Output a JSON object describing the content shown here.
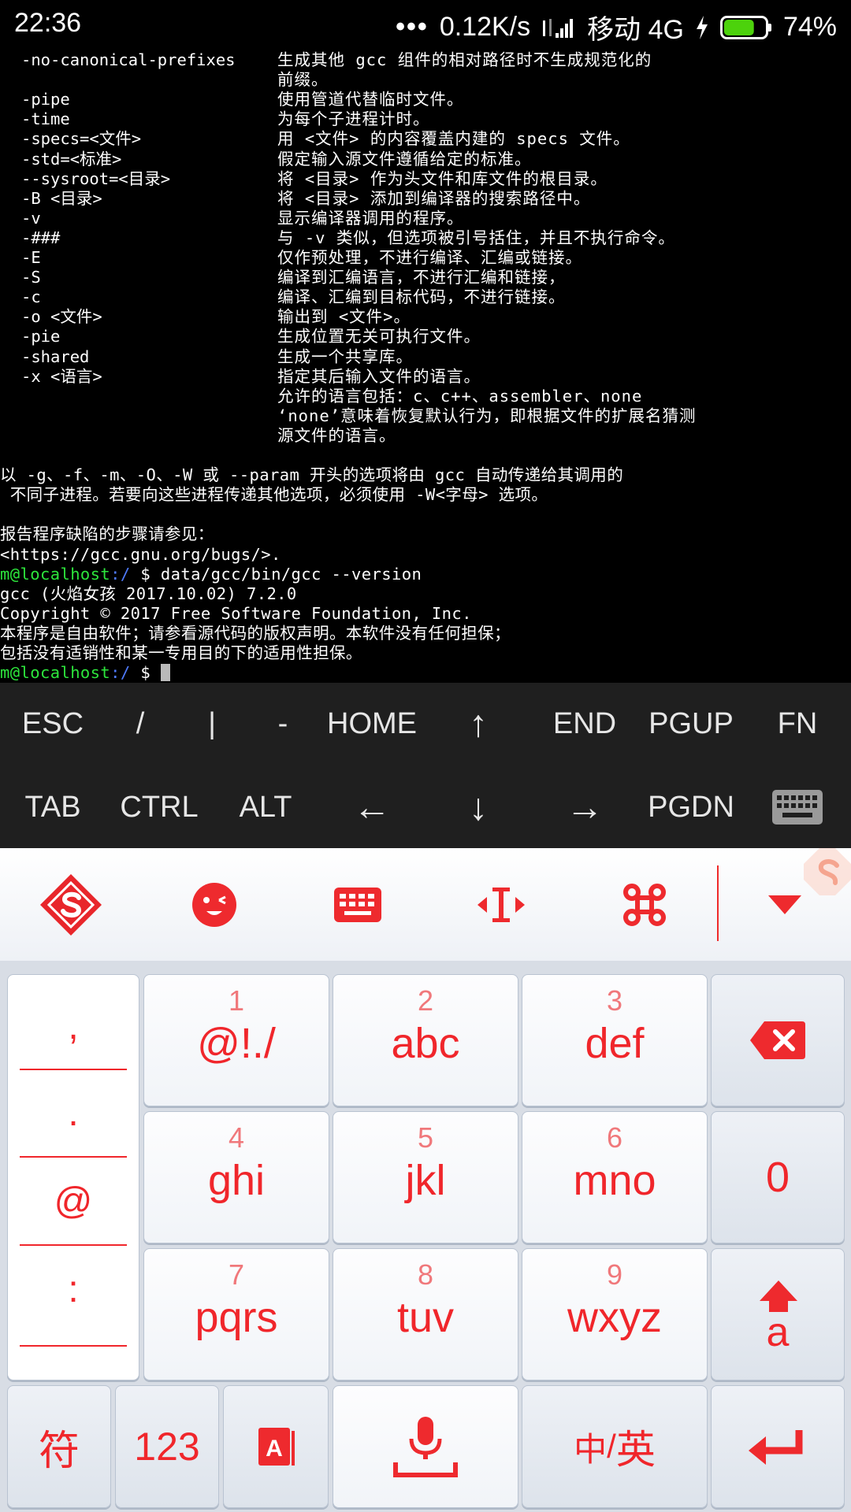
{
  "status_bar": {
    "time": "22:36",
    "dots": "•••",
    "network_speed": "0.12K/s",
    "carrier": "移动 4G",
    "battery_percent": "74%",
    "battery_level": 0.74,
    "battery_color": "#4cd20c"
  },
  "terminal": {
    "colors": {
      "user": "#2de53c",
      "path": "#4f7bff"
    },
    "options": [
      {
        "opt": "-no-canonical-prefixes",
        "desc": "生成其他 gcc 组件的相对路径时不生成规范化的"
      },
      {
        "opt": "",
        "desc": "前缀。"
      },
      {
        "opt": "-pipe",
        "desc": "使用管道代替临时文件。"
      },
      {
        "opt": "-time",
        "desc": "为每个子进程计时。"
      },
      {
        "opt": "-specs=<文件>",
        "desc": "用 <文件> 的内容覆盖内建的 specs 文件。"
      },
      {
        "opt": "-std=<标准>",
        "desc": "假定输入源文件遵循给定的标准。"
      },
      {
        "opt": "--sysroot=<目录>",
        "desc": "将 <目录> 作为头文件和库文件的根目录。"
      },
      {
        "opt": "-B <目录>",
        "desc": "将 <目录> 添加到编译器的搜索路径中。"
      },
      {
        "opt": "-v",
        "desc": "显示编译器调用的程序。"
      },
      {
        "opt": "-###",
        "desc": "与 -v 类似，但选项被引号括住，并且不执行命令。"
      },
      {
        "opt": "-E",
        "desc": "仅作预处理，不进行编译、汇编或链接。"
      },
      {
        "opt": "-S",
        "desc": "编译到汇编语言，不进行汇编和链接，"
      },
      {
        "opt": "-c",
        "desc": "编译、汇编到目标代码，不进行链接。"
      },
      {
        "opt": "-o <文件>",
        "desc": "输出到 <文件>。"
      },
      {
        "opt": "-pie",
        "desc": "生成位置无关可执行文件。"
      },
      {
        "opt": "-shared",
        "desc": "生成一个共享库。"
      },
      {
        "opt": "-x <语言>",
        "desc": "指定其后输入文件的语言。"
      },
      {
        "opt": "",
        "desc": "允许的语言包括：c、c++、assembler、none"
      },
      {
        "opt": "",
        "desc": "‘none’意味着恢复默认行为，即根据文件的扩展名猜测"
      },
      {
        "opt": "",
        "desc": "源文件的语言。"
      }
    ],
    "note_lines": [
      "以 -g、-f、-m、-O、-W 或 --param 开头的选项将由 gcc 自动传递给其调用的",
      " 不同子进程。若要向这些进程传递其他选项，必须使用 -W<字母> 选项。"
    ],
    "bug_lines": [
      "报告程序缺陷的步骤请参见：",
      "<https://gcc.gnu.org/bugs/>."
    ],
    "prompt_user": "m@localhost",
    "prompt_sep": ":",
    "prompt_path": "/",
    "prompt_symbol": " $ ",
    "command": "data/gcc/bin/gcc --version",
    "version_lines": [
      "gcc (火焰女孩 2017.10.02) 7.2.0",
      "Copyright © 2017 Free Software Foundation, Inc.",
      "本程序是自由软件；请参看源代码的版权声明。本软件没有任何担保；",
      "包括没有适销性和某一专用目的下的适用性担保。"
    ]
  },
  "extra_keys": {
    "row1": [
      "ESC",
      "/",
      "|",
      "-",
      "HOME",
      "↑",
      "END",
      "PGUP",
      "FN"
    ],
    "row2": [
      "TAB",
      "CTRL",
      "ALT",
      "←",
      "↓",
      "→",
      "PGDN"
    ]
  },
  "ime_toolbar": {
    "icons": [
      "sogou-logo-icon",
      "emoji-icon",
      "keyboard-layout-icon",
      "cursor-move-icon",
      "command-icon",
      "collapse-icon"
    ]
  },
  "keyboard": {
    "accent_color": "#f0262b",
    "punctuation": [
      ",",
      ".",
      "@",
      ":"
    ],
    "keys": [
      {
        "num": "1",
        "letters": "@!./"
      },
      {
        "num": "2",
        "letters": "abc"
      },
      {
        "num": "3",
        "letters": "def"
      },
      {
        "num": "4",
        "letters": "ghi"
      },
      {
        "num": "5",
        "letters": "jkl"
      },
      {
        "num": "6",
        "letters": "mno"
      },
      {
        "num": "7",
        "letters": "pqrs"
      },
      {
        "num": "8",
        "letters": "tuv"
      },
      {
        "num": "9",
        "letters": "wxyz"
      }
    ],
    "zero": "0",
    "shift_label": "a",
    "symbols_label": "符",
    "numbers_label": "123",
    "lang_label_cn": "中",
    "lang_label_sep": "/",
    "lang_label_en": "英"
  }
}
